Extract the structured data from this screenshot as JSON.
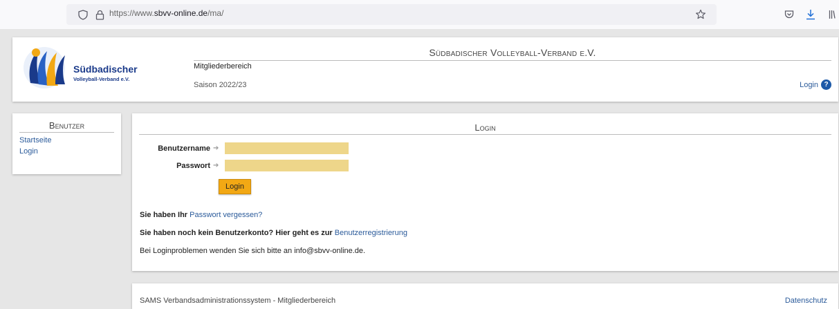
{
  "browser": {
    "url_prefix": "https://www.",
    "url_domain": "sbvv-online.de",
    "url_path": "/ma/",
    "icons": [
      "shield-icon",
      "lock-icon",
      "star-icon",
      "pocket-icon",
      "download-icon",
      "library-icon"
    ]
  },
  "header": {
    "logo_text": "Südbadischer",
    "logo_subtext": "Volleyball-Verband e.V.",
    "title": "Südbadischer Volleyball-Verband e.V.",
    "area": "Mitgliederbereich",
    "season": "Saison 2022/23",
    "login_label": "Login",
    "help_glyph": "?"
  },
  "sidebar": {
    "title": "Benutzer",
    "items": [
      {
        "label": "Startseite"
      },
      {
        "label": "Login"
      }
    ]
  },
  "main": {
    "title": "Login",
    "username_label": "Benutzername",
    "username_value": "",
    "password_label": "Passwort",
    "password_value": "",
    "arrow": "➔",
    "login_button": "Login",
    "forgot_prefix": "Sie haben Ihr",
    "forgot_link": "Passwort vergessen?",
    "register_prefix": "Sie haben noch kein Benutzerkonto? Hier geht es zur",
    "register_link": "Benutzerregistrierung",
    "problem_text": "Bei Loginproblemen wenden Sie sich bitte an info@sbvv-online.de."
  },
  "footer": {
    "left": "SAMS Verbandsadministrationssystem - Mitgliederbereich",
    "right": "Datenschutz"
  },
  "colors": {
    "input_bg": "#eed68a",
    "button_bg": "#f2a814",
    "link": "#2a5a9a",
    "help": "#1e5aa8"
  }
}
